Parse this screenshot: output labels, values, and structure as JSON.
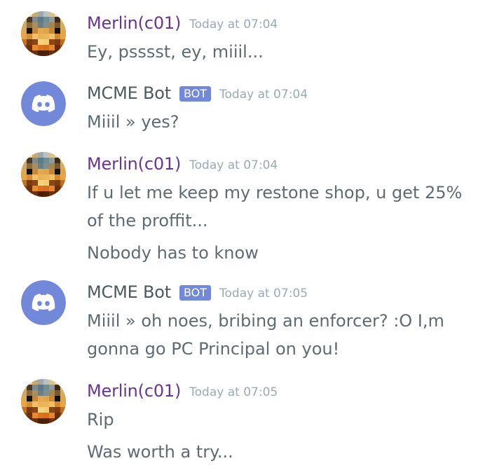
{
  "messages": [
    {
      "author": "Merlin(c01)",
      "timestamp": "Today at 07:04",
      "avatar": "minecraft-skin-avatar",
      "lines": [
        "Ey, psssst, ey, miiil..."
      ]
    },
    {
      "author": "MCME Bot",
      "bot_tag": "BOT",
      "timestamp": "Today at 07:04",
      "avatar": "discord-logo-avatar",
      "lines": [
        "Miiil »  yes?"
      ]
    },
    {
      "author": "Merlin(c01)",
      "timestamp": "Today at 07:04",
      "avatar": "minecraft-skin-avatar",
      "lines": [
        "If u let me keep my restone shop, u get 25% of the proffit...",
        "Nobody has to know"
      ]
    },
    {
      "author": "MCME Bot",
      "bot_tag": "BOT",
      "timestamp": "Today at 07:05",
      "avatar": "discord-logo-avatar",
      "lines": [
        "Miiil »  oh noes, bribing an enforcer? :O I,m gonna go PC Principal on you!"
      ]
    },
    {
      "author": "Merlin(c01)",
      "timestamp": "Today at 07:05",
      "avatar": "minecraft-skin-avatar",
      "lines": [
        "Rip",
        "Was worth a try..."
      ]
    }
  ],
  "colors": {
    "merlin_name": "#69368f",
    "bot_name": "#4c5a60",
    "bot_tag_bg": "#7289da",
    "timestamp": "#99aab5",
    "message_text": "#5e6b73",
    "discord_avatar_bg": "#7289da"
  }
}
